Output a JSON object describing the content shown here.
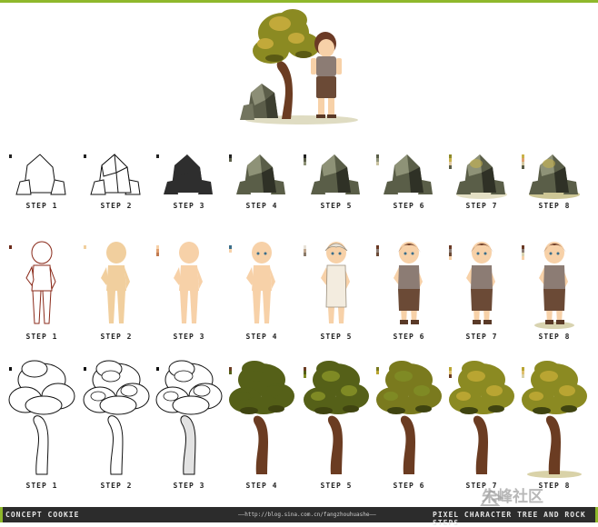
{
  "rows": [
    {
      "name": "rock",
      "labels": [
        "STEP 1",
        "STEP 2",
        "STEP 3",
        "STEP 4",
        "STEP 5",
        "STEP 6",
        "STEP 7",
        "STEP 8"
      ]
    },
    {
      "name": "character",
      "labels": [
        "STEP 1",
        "STEP 2",
        "STEP 3",
        "STEP 4",
        "STEP 5",
        "STEP 6",
        "STEP 7",
        "STEP 8"
      ]
    },
    {
      "name": "tree",
      "labels": [
        "STEP 1",
        "STEP 2",
        "STEP 3",
        "STEP 4",
        "STEP 5",
        "STEP 6",
        "STEP 7",
        "STEP 8"
      ]
    }
  ],
  "footer": {
    "left": "CONCEPT COOKIE",
    "middle": "——http://blog.sina.com.cn/fangzhouhuashe——",
    "right": "PIXEL CHARACTER TREE AND ROCK STEPS"
  },
  "watermark": "朱峰社区",
  "colors": {
    "accent_bar": "#8fb82c",
    "footer_bg": "#2c2c2c",
    "rock_dark": "#2e2e2e",
    "rock_mid": "#5a5e48",
    "rock_light": "#8e9277",
    "skin": "#f7d1a8",
    "hair": "#6b3a25",
    "shirt": "#8c7c74",
    "tree_leaf": "#6f7a1c",
    "tree_leaf_light": "#b9a532",
    "trunk": "#6b3c22"
  },
  "icons": [
    "hero-illustration",
    "rock-sprite",
    "character-sprite",
    "tree-sprite",
    "color-swatch",
    "watermark-logo"
  ]
}
